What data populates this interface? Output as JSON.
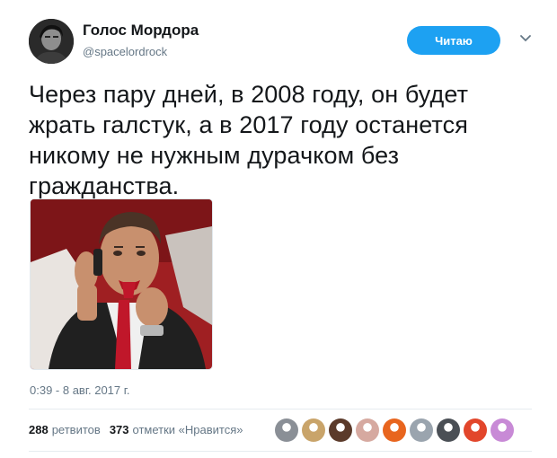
{
  "user": {
    "name": "Голос Мордора",
    "handle": "@spacelordrock"
  },
  "follow_button": {
    "label": "Читаю"
  },
  "tweet": {
    "lines": [
      "Через пару дней, в 2008 году, он будет",
      "жрать галстук, а в 2017 году останется",
      "никому не нужным дурачком без",
      "гражданства."
    ],
    "timestamp": "0:39 - 8 авг. 2017 г."
  },
  "stats": {
    "retweets_count": "288",
    "retweets_label": "ретвитов",
    "likes_count": "373",
    "likes_label": "отметки «Нравится»"
  },
  "colors": {
    "accent": "#1da1f2",
    "secondary_text": "#657786",
    "primary_text": "#14171a"
  },
  "likers": [
    {
      "name": "liker-avatar-1",
      "color": "#8a8f96"
    },
    {
      "name": "liker-avatar-2",
      "color": "#c9a46a"
    },
    {
      "name": "liker-avatar-3",
      "color": "#5b3a2a"
    },
    {
      "name": "liker-avatar-4",
      "color": "#d6a9a0"
    },
    {
      "name": "liker-avatar-5",
      "color": "#e8651e"
    },
    {
      "name": "liker-avatar-6",
      "color": "#9aa4ae"
    },
    {
      "name": "liker-avatar-7",
      "color": "#4a4f55"
    },
    {
      "name": "liker-avatar-8",
      "color": "#e2462b"
    },
    {
      "name": "liker-avatar-9",
      "color": "#c88ad6"
    }
  ]
}
